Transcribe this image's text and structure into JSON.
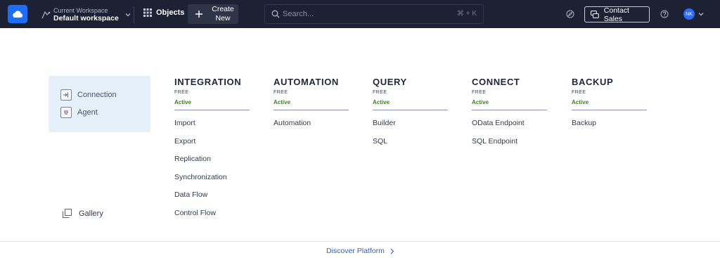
{
  "header": {
    "logo_icon": "cloud-icon",
    "workspace": {
      "label": "Current Workspace",
      "name": "Default workspace"
    },
    "objects_label": "Objects",
    "create_label": "Create New",
    "search": {
      "placeholder": "Search...",
      "shortcut": "⌘ + K"
    },
    "contact_label": "Contact Sales",
    "avatar_initials": "NK"
  },
  "sidebar": {
    "items": [
      {
        "label": "Connection",
        "icon": "connection-icon"
      },
      {
        "label": "Agent",
        "icon": "agent-icon"
      }
    ],
    "gallery_label": "Gallery"
  },
  "products": [
    {
      "title": "INTEGRATION",
      "plan": "FREE",
      "status": "Active",
      "items": [
        "Import",
        "Export",
        "Replication",
        "Synchronization",
        "Data Flow",
        "Control Flow"
      ]
    },
    {
      "title": "AUTOMATION",
      "plan": "FREE",
      "status": "Active",
      "items": [
        "Automation"
      ]
    },
    {
      "title": "QUERY",
      "plan": "FREE",
      "status": "Active",
      "items": [
        "Builder",
        "SQL"
      ]
    },
    {
      "title": "CONNECT",
      "plan": "FREE",
      "status": "Active",
      "items": [
        "OData Endpoint",
        "SQL Endpoint"
      ]
    },
    {
      "title": "BACKUP",
      "plan": "FREE",
      "status": "Active",
      "items": [
        "Backup"
      ]
    }
  ],
  "footer": {
    "discover_label": "Discover Platform"
  },
  "colors": {
    "topbar": "#1c2234",
    "accent": "#1d6ef5",
    "active": "#3b7f23",
    "link": "#2d64c8"
  }
}
